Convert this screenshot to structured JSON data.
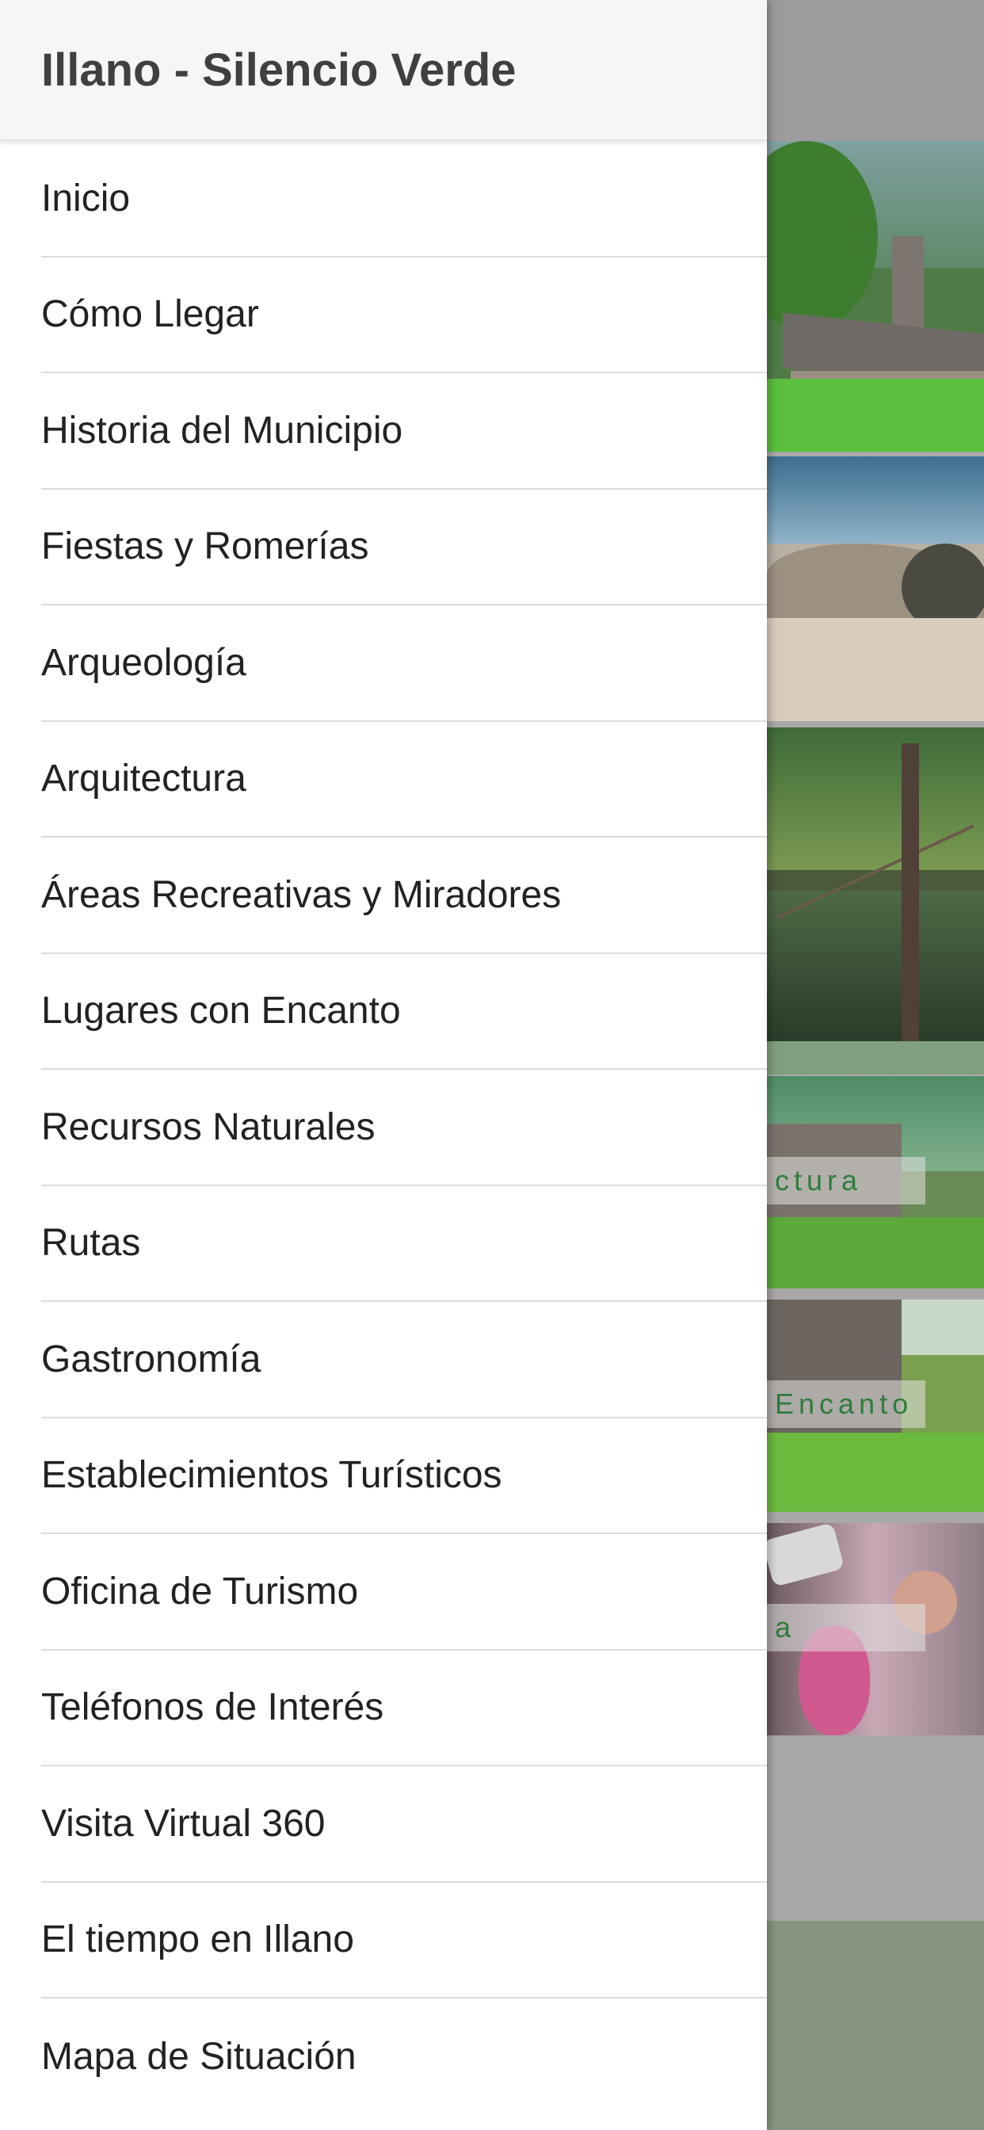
{
  "drawer": {
    "title": "Illano - Silencio Verde",
    "items": [
      {
        "label": "Inicio"
      },
      {
        "label": "Cómo Llegar"
      },
      {
        "label": "Historia del Municipio"
      },
      {
        "label": "Fiestas y Romerías"
      },
      {
        "label": "Arqueología"
      },
      {
        "label": "Arquitectura"
      },
      {
        "label": "Áreas Recreativas y Miradores"
      },
      {
        "label": "Lugares con Encanto"
      },
      {
        "label": "Recursos Naturales"
      },
      {
        "label": "Rutas"
      },
      {
        "label": "Gastronomía"
      },
      {
        "label": "Establecimientos Turísticos"
      },
      {
        "label": "Oficina de Turismo"
      },
      {
        "label": "Teléfonos de Interés"
      },
      {
        "label": "Visita Virtual 360"
      },
      {
        "label": "El tiempo en Illano"
      },
      {
        "label": "Mapa de Situación"
      }
    ]
  },
  "background": {
    "tile_captions": [
      "ctura",
      "Encanto",
      "a"
    ]
  },
  "colors": {
    "drawer_header_bg": "#f6f6f6",
    "scrim": "#a8a8a8",
    "caption_green": "#2e7d3c",
    "footer_green": "#87977f"
  }
}
